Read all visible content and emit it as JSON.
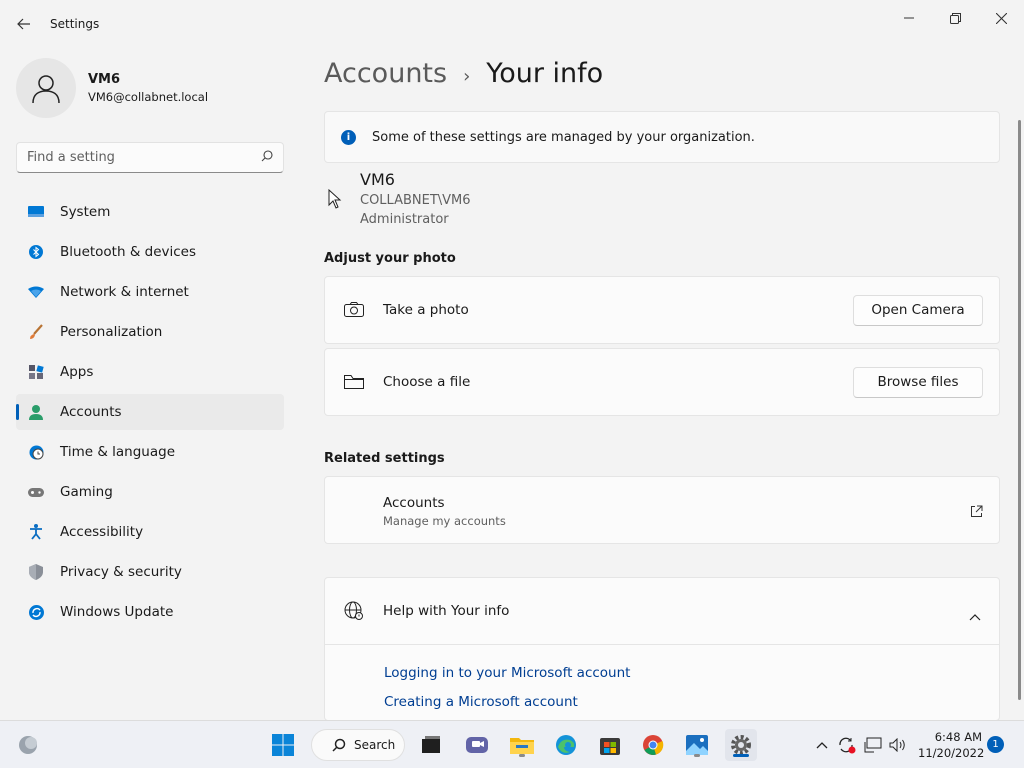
{
  "window": {
    "title": "Settings"
  },
  "profile": {
    "name": "VM6",
    "email": "VM6@collabnet.local"
  },
  "search": {
    "placeholder": "Find a setting"
  },
  "nav": {
    "items": [
      {
        "label": "System",
        "icon": "monitor-icon"
      },
      {
        "label": "Bluetooth & devices",
        "icon": "bluetooth-icon"
      },
      {
        "label": "Network & internet",
        "icon": "wifi-icon"
      },
      {
        "label": "Personalization",
        "icon": "brush-icon"
      },
      {
        "label": "Apps",
        "icon": "apps-icon"
      },
      {
        "label": "Accounts",
        "icon": "person-icon",
        "selected": true
      },
      {
        "label": "Time & language",
        "icon": "clock-globe-icon"
      },
      {
        "label": "Gaming",
        "icon": "gamepad-icon"
      },
      {
        "label": "Accessibility",
        "icon": "accessibility-icon"
      },
      {
        "label": "Privacy & security",
        "icon": "shield-icon"
      },
      {
        "label": "Windows Update",
        "icon": "update-icon"
      }
    ]
  },
  "breadcrumb": {
    "parent": "Accounts",
    "separator": "›",
    "current": "Your info"
  },
  "notice": {
    "text": "Some of these settings are managed by your organization."
  },
  "user": {
    "name": "VM6",
    "domain": "COLLABNET\\VM6",
    "role": "Administrator"
  },
  "photo": {
    "section_title": "Adjust your photo",
    "take_photo": {
      "label": "Take a photo",
      "button": "Open Camera"
    },
    "choose_file": {
      "label": "Choose a file",
      "button": "Browse files"
    }
  },
  "related": {
    "section_title": "Related settings",
    "accounts": {
      "title": "Accounts",
      "subtitle": "Manage my accounts"
    }
  },
  "help": {
    "title": "Help with Your info",
    "links": [
      "Logging in to your Microsoft account",
      "Creating a Microsoft account"
    ]
  },
  "taskbar": {
    "search_label": "Search",
    "time": "6:48 AM",
    "date": "11/20/2022",
    "notification_count": "1"
  },
  "colors": {
    "accent": "#005fb8",
    "link": "#003e92"
  }
}
